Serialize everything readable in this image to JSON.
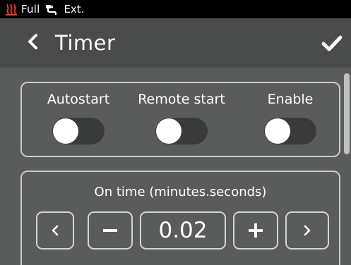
{
  "status_bar": {
    "heater_icon": "heater-icon",
    "power_label": "Full",
    "plug_icon": "plug-icon",
    "ext_label": "Ext."
  },
  "header": {
    "title": "Timer",
    "back_icon": "chevron-left-icon",
    "confirm_icon": "checkmark-icon"
  },
  "toggles": [
    {
      "label": "Autostart",
      "on": false
    },
    {
      "label": "Remote start",
      "on": false
    },
    {
      "label": "Enable",
      "on": false
    }
  ],
  "on_time": {
    "label": "On time (minutes.seconds)",
    "value": "0.02",
    "buttons": {
      "prev_icon": "chevron-left-icon",
      "decrement_icon": "minus-icon",
      "increment_icon": "plus-icon",
      "next_icon": "chevron-right-icon"
    }
  },
  "colors": {
    "status_bar_bg": "#000000",
    "header_bg": "#4a4b4b",
    "content_bg": "#5a5b5b",
    "toggle_track": "#393a3a",
    "heater_icon": "#e53935"
  }
}
